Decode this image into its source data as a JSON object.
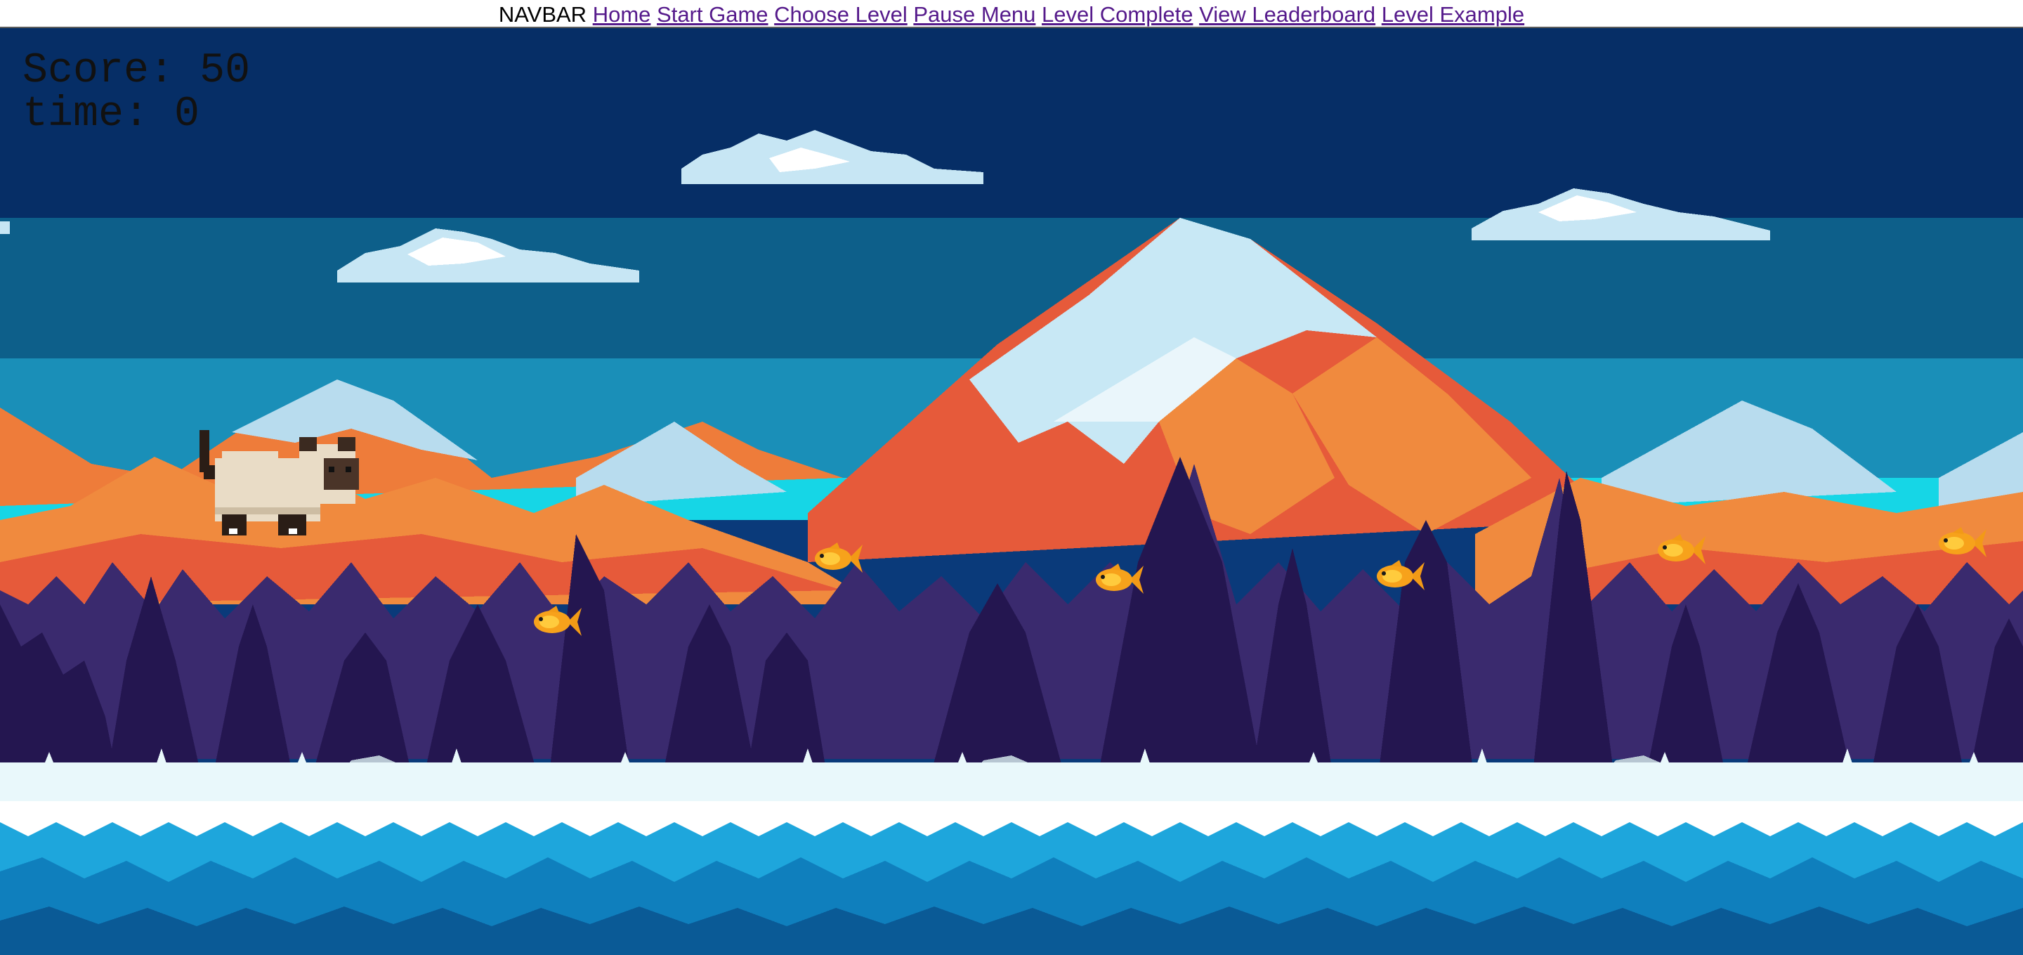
{
  "navbar": {
    "brand": "NAVBAR",
    "links": [
      "Home",
      "Start Game",
      "Choose Level",
      "Pause Menu",
      "Level Complete",
      "View Leaderboard",
      "Level Example"
    ]
  },
  "hud": {
    "score_label": "Score:",
    "score_value": "50",
    "time_label": "time:",
    "time_value": "0"
  },
  "scene": {
    "player": "cat-sprite",
    "collectibles": "fish-sprite",
    "fish_count": 6,
    "background": "pixel-art snowy mountains with forest and icy water"
  },
  "colors": {
    "sky_dark": "#062e66",
    "sky_mid": "#0d5f8a",
    "sky_light": "#1a8fb8",
    "mountain_orange": "#f08a3e",
    "mountain_red": "#e65a3a",
    "snow": "#c8e8f5",
    "tree_purple": "#3a2a6e",
    "tree_dark": "#241650",
    "ice": "#e9f8fb",
    "water": "#1ea6dc",
    "link": "#551a8b"
  }
}
